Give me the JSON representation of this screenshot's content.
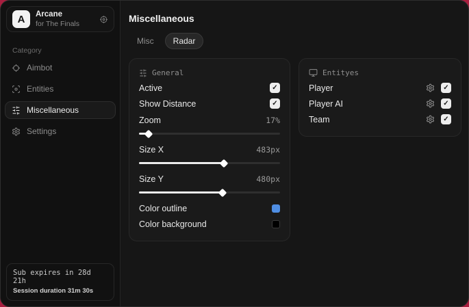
{
  "brand": {
    "initial": "A",
    "name": "Arcane",
    "subtitle": "for The Finals"
  },
  "sidebar": {
    "category_label": "Category",
    "items": [
      {
        "label": "Aimbot",
        "icon": "crosshair-icon"
      },
      {
        "label": "Entities",
        "icon": "scan-icon"
      },
      {
        "label": "Miscellaneous",
        "icon": "sliders-icon"
      },
      {
        "label": "Settings",
        "icon": "gear-icon"
      }
    ],
    "status": {
      "line1": "Sub expires in 28d 21h",
      "line2": "Session duration 31m 30s"
    }
  },
  "main": {
    "title": "Miscellaneous",
    "tabs": [
      {
        "label": "Misc"
      },
      {
        "label": "Radar"
      }
    ]
  },
  "general": {
    "title": "General",
    "icon": "sliders-icon",
    "toggles": [
      {
        "label": "Active",
        "checked": true
      },
      {
        "label": "Show Distance",
        "checked": true
      }
    ],
    "sliders": [
      {
        "label": "Zoom",
        "value": "17%",
        "percent": 7
      },
      {
        "label": "Size X",
        "value": "483px",
        "percent": 60
      },
      {
        "label": "Size Y",
        "value": "480px",
        "percent": 59
      }
    ],
    "colors": [
      {
        "label": "Color outline",
        "swatch": "#4f8ee3"
      },
      {
        "label": "Color background",
        "swatch": "#000000"
      }
    ]
  },
  "entities": {
    "title": "Entityes",
    "icon": "monitor-icon",
    "rows": [
      {
        "label": "Player",
        "checked": true
      },
      {
        "label": "Player AI",
        "checked": true
      },
      {
        "label": "Team",
        "checked": true
      }
    ]
  },
  "glyphs": {
    "check": "✓"
  },
  "colors": {
    "backdrop": "#a81e3f",
    "accent_blue": "#4f8ee3",
    "window_bg": "#161616"
  }
}
